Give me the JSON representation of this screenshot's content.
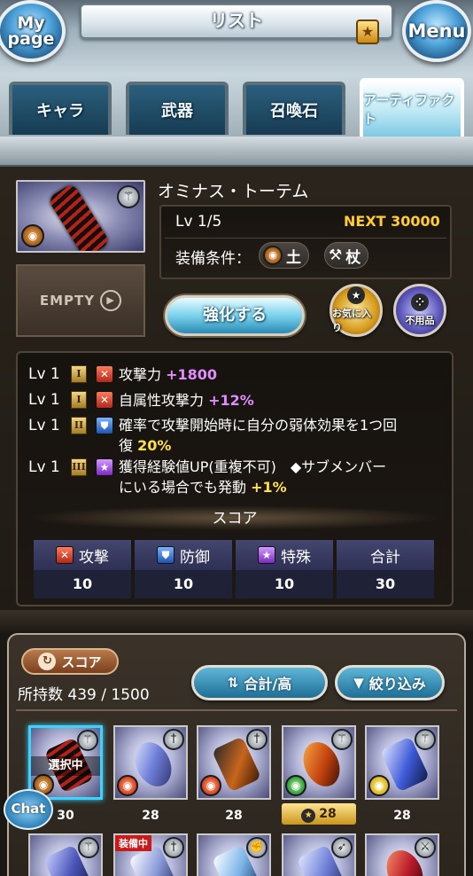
{
  "header": {
    "title": "リスト",
    "mypage_label": "My page",
    "menu_label": "Menu",
    "star_glyph": "★"
  },
  "tabs": [
    {
      "label": "キャラ",
      "active": false
    },
    {
      "label": "武器",
      "active": false
    },
    {
      "label": "召喚石",
      "active": false
    },
    {
      "label": "アーティファクト",
      "active": true
    }
  ],
  "artifact": {
    "name": "オミナス・トーテム",
    "lv": "Lv 1/5",
    "next": "NEXT 30000",
    "equip_cond_label": "装備条件：",
    "element": {
      "name": "土",
      "color": "#a05a14"
    },
    "weapon_type": "杖",
    "empty_label": "EMPTY",
    "enhance_label": "強化する",
    "fav_label": "お気に入り",
    "junk_label": "不用品"
  },
  "skills": [
    {
      "lv": "Lv 1",
      "rank": "I",
      "type": "atk",
      "text": "攻撃力 ",
      "value": "+1800",
      "value_style": "purple"
    },
    {
      "lv": "Lv 1",
      "rank": "I",
      "type": "atk",
      "text": "自属性攻撃力 ",
      "value": "+12%",
      "value_style": "purple"
    },
    {
      "lv": "Lv 1",
      "rank": "II",
      "type": "def",
      "text": "確率で攻撃開始時に自分の弱体効果を1つ回",
      "text2": "復 ",
      "value": "20%",
      "value_style": "yellow"
    },
    {
      "lv": "Lv 1",
      "rank": "III",
      "type": "spc",
      "text": "獲得経験値UP(重複不可)　◆サブメンバー",
      "text2": "にいる場合でも発動 ",
      "value": "+1%",
      "value_style": "yellow"
    }
  ],
  "score": {
    "title": "スコア",
    "columns": [
      {
        "label": "攻撃",
        "value": "10",
        "type": "atk"
      },
      {
        "label": "防御",
        "value": "10",
        "type": "def"
      },
      {
        "label": "特殊",
        "value": "10",
        "type": "spc"
      },
      {
        "label": "合計",
        "value": "30",
        "type": ""
      }
    ]
  },
  "inventory": {
    "sort_label": "スコア",
    "count_text": "所持数 439 / 1500",
    "order_label": "合計/高",
    "filter_label": "絞り込み",
    "selected_label": "選択中",
    "equipped_label": "装備中",
    "chat_label": "Chat",
    "items": [
      {
        "score": "30",
        "element": "earth",
        "selected": true,
        "fav": false
      },
      {
        "score": "28",
        "element": "fire",
        "selected": false,
        "fav": false
      },
      {
        "score": "28",
        "element": "fire",
        "selected": false,
        "fav": false
      },
      {
        "score": "28",
        "element": "wind",
        "selected": false,
        "fav": true
      },
      {
        "score": "28",
        "element": "light",
        "selected": false,
        "fav": false
      }
    ]
  },
  "colors": {
    "accent_blue": "#3bd3ff",
    "next_gold": "#ffcc33",
    "value_purple": "#e08cff",
    "value_yellow": "#ffe14a"
  }
}
